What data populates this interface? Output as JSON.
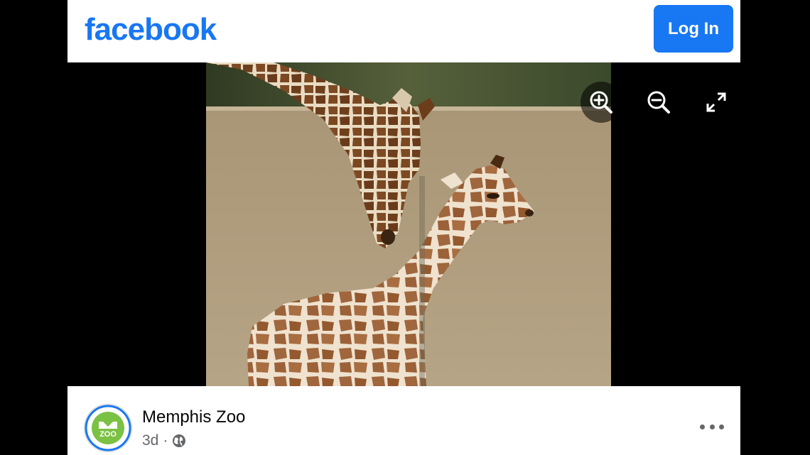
{
  "header": {
    "logo_text": "facebook",
    "login_label": "Log In",
    "brand_color": "#1877f2"
  },
  "viewer": {
    "tools": [
      "zoom-in-icon",
      "zoom-out-icon",
      "expand-icon"
    ],
    "photo_subject": "giraffe-photo"
  },
  "post": {
    "page_name": "Memphis Zoo",
    "time": "3d",
    "separator": "·",
    "audience_icon": "globe-icon",
    "menu_icon": "more-icon",
    "avatar_text": "ZOO"
  }
}
